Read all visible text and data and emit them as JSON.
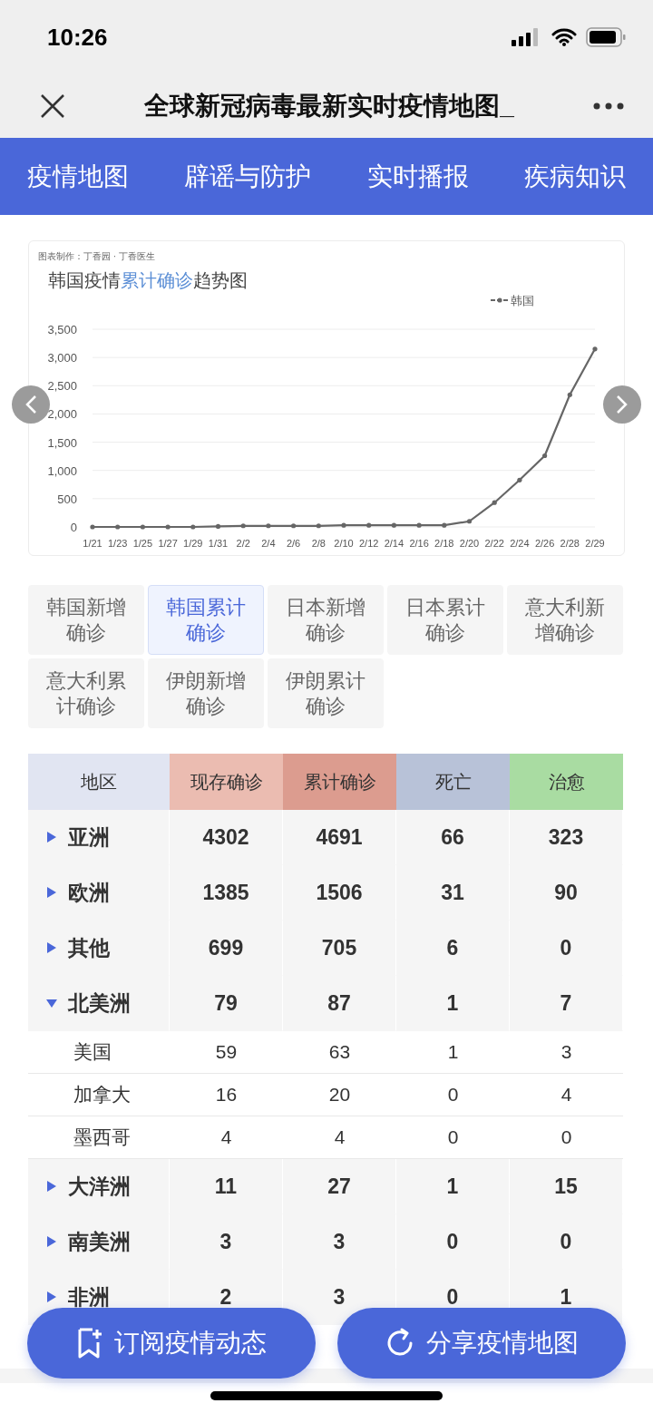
{
  "status_bar": {
    "time": "10:26"
  },
  "title_bar": {
    "title": "全球新冠病毒最新实时疫情地图_"
  },
  "nav_tabs": [
    {
      "label": "疫情地图"
    },
    {
      "label": "辟谣与防护"
    },
    {
      "label": "实时播报"
    },
    {
      "label": "疾病知识"
    }
  ],
  "chart_card": {
    "credit": "图表制作：丁香园 · 丁香医生",
    "title": {
      "before": "韩国疫情",
      "highlight": "累计确诊",
      "after": "趋势图"
    },
    "chart_data": {
      "type": "line",
      "grid": true,
      "categories": [
        "1/21",
        "1/23",
        "1/25",
        "1/27",
        "1/29",
        "1/31",
        "2/2",
        "2/4",
        "2/6",
        "2/8",
        "2/10",
        "2/12",
        "2/14",
        "2/16",
        "2/18",
        "2/20",
        "2/22",
        "2/24",
        "2/26",
        "2/28",
        "2/29"
      ],
      "series": [
        {
          "name": "韩国",
          "color": "#666666",
          "values": [
            0,
            0,
            0,
            0,
            0,
            10,
            20,
            20,
            20,
            20,
            30,
            30,
            30,
            30,
            30,
            100,
            430,
            830,
            1260,
            2340,
            3150
          ]
        }
      ],
      "ylim": [
        0,
        3500
      ],
      "yticks": [
        {
          "value": 0,
          "label": "0"
        },
        {
          "value": 500,
          "label": "500"
        },
        {
          "value": 1000,
          "label": "1,000"
        },
        {
          "value": 1500,
          "label": "1,500"
        },
        {
          "value": 2000,
          "label": "2,000"
        },
        {
          "value": 2500,
          "label": "2,500"
        },
        {
          "value": 3000,
          "label": "3,000"
        },
        {
          "value": 3500,
          "label": "3,500"
        }
      ]
    }
  },
  "chart_options": [
    {
      "label": "韩国新增确诊",
      "selected": false
    },
    {
      "label": "韩国累计确诊",
      "selected": true
    },
    {
      "label": "日本新增确诊",
      "selected": false
    },
    {
      "label": "日本累计确诊",
      "selected": false
    },
    {
      "label": "意大利新增确诊",
      "selected": false
    },
    {
      "label": "意大利累计确诊",
      "selected": false
    },
    {
      "label": "伊朗新增确诊",
      "selected": false
    },
    {
      "label": "伊朗累计确诊",
      "selected": false
    }
  ],
  "table": {
    "columns": [
      {
        "label": "地区",
        "color": "#e1e5f2"
      },
      {
        "label": "现存确诊",
        "color": "#ebbcb1"
      },
      {
        "label": "累计确诊",
        "color": "#dc9c8f"
      },
      {
        "label": "死亡",
        "color": "#b8c2d8"
      },
      {
        "label": "治愈",
        "color": "#a9dca2"
      }
    ],
    "rows": [
      {
        "region": "亚洲",
        "values": [
          "4302",
          "4691",
          "66",
          "323"
        ],
        "expanded": false
      },
      {
        "region": "欧洲",
        "values": [
          "1385",
          "1506",
          "31",
          "90"
        ],
        "expanded": false
      },
      {
        "region": "其他",
        "values": [
          "699",
          "705",
          "6",
          "0"
        ],
        "expanded": false
      },
      {
        "region": "北美洲",
        "values": [
          "79",
          "87",
          "1",
          "7"
        ],
        "expanded": true,
        "children": [
          {
            "region": "美国",
            "values": [
              "59",
              "63",
              "1",
              "3"
            ]
          },
          {
            "region": "加拿大",
            "values": [
              "16",
              "20",
              "0",
              "4"
            ]
          },
          {
            "region": "墨西哥",
            "values": [
              "4",
              "4",
              "0",
              "0"
            ]
          }
        ]
      },
      {
        "region": "大洋洲",
        "values": [
          "11",
          "27",
          "1",
          "15"
        ],
        "expanded": false
      },
      {
        "region": "南美洲",
        "values": [
          "3",
          "3",
          "0",
          "0"
        ],
        "expanded": false
      },
      {
        "region": "非洲",
        "values": [
          "2",
          "3",
          "0",
          "1"
        ],
        "expanded": false
      }
    ]
  },
  "action_buttons": [
    {
      "kind": "subscribe",
      "label": "订阅疫情动态"
    },
    {
      "kind": "share",
      "label": "分享疫情地图"
    }
  ]
}
